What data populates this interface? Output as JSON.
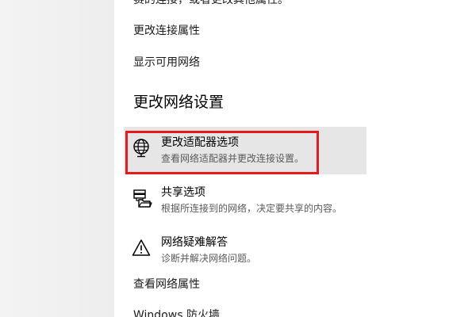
{
  "top_partial_text": "赛的连接，或者更改其他属性。",
  "links": {
    "change_connection_properties": "更改连接属性",
    "show_available_networks": "显示可用网络",
    "view_network_properties": "查看网络属性",
    "windows_firewall": "Windows 防火墙"
  },
  "section_title": "更改网络设置",
  "options": [
    {
      "title": "更改适配器选项",
      "description": "查看网络适配器并更改连接设置。",
      "icon": "network-adapter-icon"
    },
    {
      "title": "共享选项",
      "description": "根据所连接到的网络，决定要共享的内容。",
      "icon": "sharing-icon"
    },
    {
      "title": "网络疑难解答",
      "description": "诊断并解决网络问题。",
      "icon": "warning-triangle-icon"
    }
  ],
  "colors": {
    "highlight_border": "#e31b1b",
    "hover_background": "#e6e6e6",
    "left_pane_background": "#f0f0f0"
  }
}
